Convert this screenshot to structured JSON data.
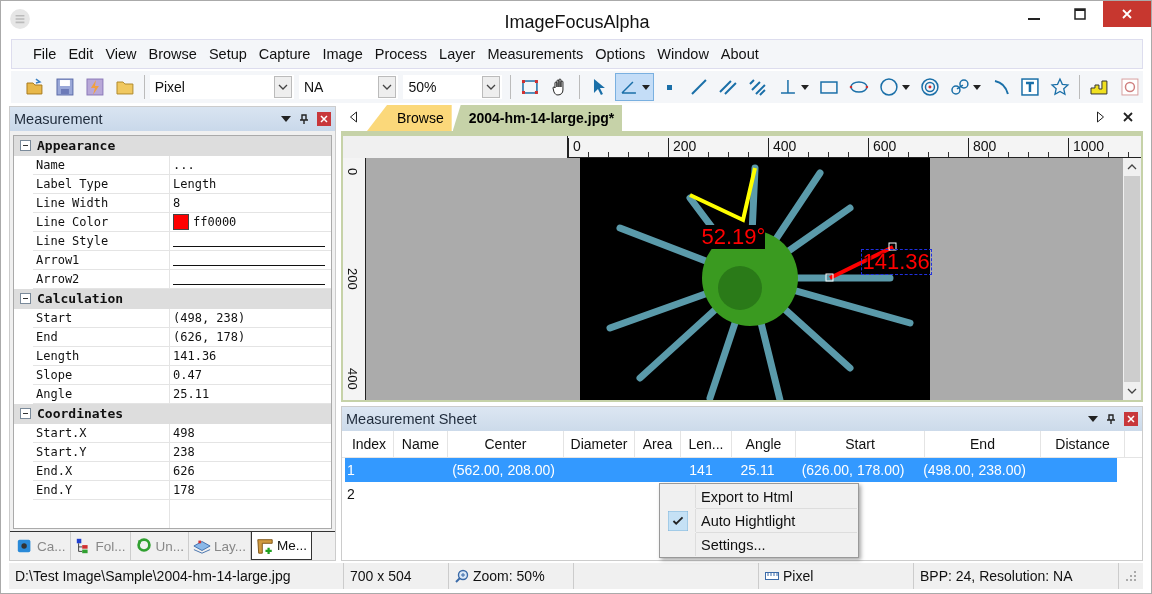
{
  "window": {
    "title": "ImageFocusAlpha"
  },
  "menu": [
    "File",
    "Edit",
    "View",
    "Browse",
    "Setup",
    "Capture",
    "Image",
    "Process",
    "Layer",
    "Measurements",
    "Options",
    "Window",
    "About"
  ],
  "toolbar": {
    "unit": "Pixel",
    "calibration": "NA",
    "zoom": "50%",
    "file_tools": [
      {
        "kind": "open"
      },
      {
        "kind": "save"
      },
      {
        "kind": "save-all"
      },
      {
        "kind": "folder"
      }
    ],
    "tools": [
      {
        "kind": "select",
        "selected": false,
        "caret": false
      },
      {
        "kind": "hand",
        "selected": false,
        "caret": false
      },
      {
        "kind": "pointer",
        "selected": false,
        "caret": false
      },
      {
        "kind": "angle",
        "selected": true,
        "caret": true
      },
      {
        "kind": "point",
        "selected": false,
        "caret": false
      },
      {
        "kind": "line",
        "selected": false,
        "caret": false
      },
      {
        "kind": "double-line",
        "selected": false,
        "caret": false
      },
      {
        "kind": "triple-line",
        "selected": false,
        "caret": false
      },
      {
        "kind": "perpendicular",
        "selected": false,
        "caret": true
      },
      {
        "kind": "rectangle",
        "selected": false,
        "caret": false
      },
      {
        "kind": "ellipse",
        "selected": false,
        "caret": false
      },
      {
        "kind": "circle",
        "selected": false,
        "caret": true
      },
      {
        "kind": "target",
        "selected": false,
        "caret": false
      },
      {
        "kind": "link",
        "selected": false,
        "caret": true
      },
      {
        "kind": "arc",
        "selected": false,
        "caret": false
      },
      {
        "kind": "text",
        "selected": false,
        "caret": false
      },
      {
        "kind": "star",
        "selected": false,
        "caret": false
      }
    ],
    "extra_tools": [
      {
        "kind": "bars"
      },
      {
        "kind": "g-box"
      }
    ]
  },
  "left_panel": {
    "title": "Measurement",
    "categories": [
      {
        "name": "Appearance",
        "expanded": true,
        "rows": [
          {
            "name": "Name",
            "kind": "text",
            "value": "..."
          },
          {
            "name": "Label Type",
            "kind": "text",
            "value": "Length"
          },
          {
            "name": "Line Width",
            "kind": "text",
            "value": "8"
          },
          {
            "name": "Line Color",
            "kind": "color",
            "value": "ff0000",
            "color": "#ff0000"
          },
          {
            "name": "Line Style",
            "kind": "line"
          },
          {
            "name": "Arrow1",
            "kind": "line"
          },
          {
            "name": "Arrow2",
            "kind": "line"
          }
        ]
      },
      {
        "name": "Calculation",
        "expanded": true,
        "rows": [
          {
            "name": "Start",
            "kind": "text",
            "value": "(498, 238)"
          },
          {
            "name": "End",
            "kind": "text",
            "value": "(626, 178)"
          },
          {
            "name": "Length",
            "kind": "text",
            "value": "141.36"
          },
          {
            "name": "Slope",
            "kind": "text",
            "value": "0.47"
          },
          {
            "name": "Angle",
            "kind": "text",
            "value": "25.11"
          }
        ]
      },
      {
        "name": "Coordinates",
        "expanded": true,
        "rows": [
          {
            "name": "Start.X",
            "kind": "text",
            "value": "498"
          },
          {
            "name": "Start.Y",
            "kind": "text",
            "value": "238"
          },
          {
            "name": "End.X",
            "kind": "text",
            "value": "626"
          },
          {
            "name": "End.Y",
            "kind": "text",
            "value": "178"
          }
        ]
      }
    ],
    "tabs": [
      {
        "label": "Ca...",
        "kind": "camera",
        "selected": false
      },
      {
        "label": "Fol...",
        "kind": "folders",
        "selected": false
      },
      {
        "label": "Un...",
        "kind": "undo",
        "selected": false
      },
      {
        "label": "Lay...",
        "kind": "layers",
        "selected": false
      },
      {
        "label": "Me...",
        "kind": "measure",
        "selected": true
      }
    ]
  },
  "document_tabs": [
    {
      "label": "Browse",
      "selected": false
    },
    {
      "label": "2004-hm-14-large.jpg*",
      "selected": true
    }
  ],
  "rulers": {
    "horizontal": [
      "0",
      "200",
      "400",
      "600",
      "800",
      "1000"
    ],
    "vertical": [
      "0",
      "200",
      "400"
    ]
  },
  "image": {
    "annotations": [
      {
        "kind": "angle",
        "label": "52.19°"
      },
      {
        "kind": "length",
        "label": "141.36"
      }
    ]
  },
  "sheet": {
    "title": "Measurement Sheet",
    "columns": [
      "Index",
      "Name",
      "Center",
      "Diameter",
      "Area",
      "Len...",
      "Angle",
      "Start",
      "End",
      "Distance"
    ],
    "rows": [
      {
        "selected": true,
        "cells": [
          "1",
          "",
          "(562.00, 208.00)",
          "",
          "",
          "141",
          "25.11",
          "(626.00, 178.00)",
          "(498.00, 238.00)",
          ""
        ]
      },
      {
        "selected": false,
        "cells": [
          "2",
          "",
          "",
          "",
          "",
          "",
          "",
          "",
          "",
          ""
        ]
      }
    ]
  },
  "context_menu": [
    {
      "label": "Export to Html",
      "checked": false
    },
    {
      "label": "Auto Hightlight",
      "checked": true
    },
    {
      "label": "Settings...",
      "checked": false
    }
  ],
  "status_bar": {
    "path": "D:\\Test Image\\Sample\\2004-hm-14-large.jpg",
    "size": "700 x 504",
    "zoom": "Zoom: 50%",
    "unit": "Pixel",
    "info": "BPP: 24, Resolution: NA"
  }
}
